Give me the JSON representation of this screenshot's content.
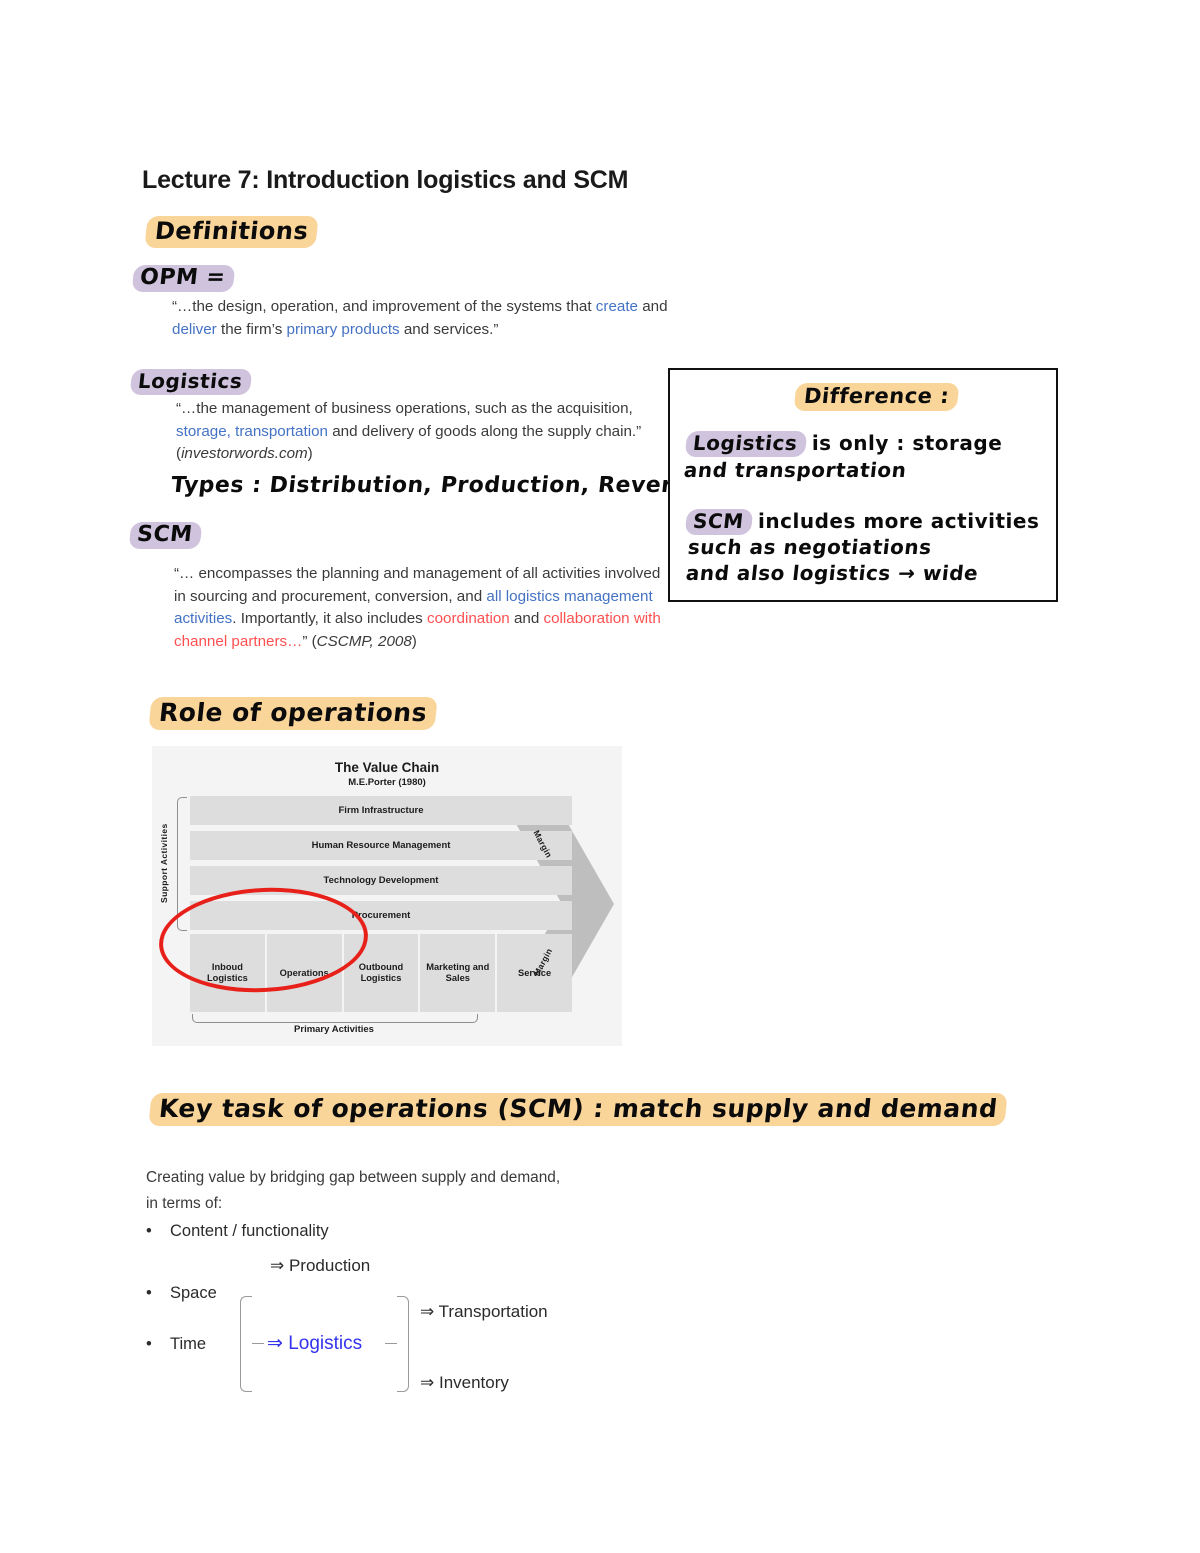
{
  "document": {
    "title": "Lecture 7: Introduction logistics and SCM"
  },
  "colors": {
    "highlight_orange": "#fad59a",
    "highlight_purple": "#cfc3de",
    "text_blue": "#4472c4",
    "text_red": "#ff5050",
    "logistics_blue": "#3333ee",
    "annotation_red": "#e8201a",
    "figure_bg": "#f4f4f4",
    "figure_box": "#dddddd",
    "figure_margin": "#bebebe"
  },
  "sections": {
    "definitions": {
      "heading": "Definitions",
      "opm": {
        "label": "OPM =",
        "quote_part1": "“…the design, operation, and improvement of the systems that ",
        "quote_create": "create",
        "quote_mid1": " and ",
        "quote_deliver": "deliver",
        "quote_mid2": " the firm’s ",
        "quote_primary": "primary products",
        "quote_end": " and services.”"
      },
      "logistics": {
        "label": "Logistics",
        "quote_part1": "“…the management of business operations, such as the acquisition, ",
        "quote_blue": "storage, transportation",
        "quote_part2": " and delivery of goods along the supply chain.” (",
        "quote_source": "investorwords.com",
        "quote_end": ")",
        "types_note": "Types : Distribution, Production, Reverse"
      },
      "scm": {
        "label": "SCM",
        "quote_part1": "“… encompasses the planning and management of all activities involved in sourcing and procurement, conversion, and ",
        "quote_blue": "all logistics management activities",
        "quote_part2": ". Importantly, it also includes ",
        "quote_red1": "coordination",
        "quote_part3": " and ",
        "quote_red2": "collaboration with channel partners…",
        "quote_part4": "” (",
        "quote_source": "CSCMP, 2008",
        "quote_end": ")"
      }
    },
    "difference_box": {
      "heading": "Difference :",
      "logistics_chip": "Logistics",
      "logistics_line1": "is only : storage",
      "logistics_line2": "and transportation",
      "scm_chip": "SCM",
      "scm_line1": "includes more activities",
      "scm_line2": "such as negotiations",
      "scm_line3": "and also logistics  → wide"
    },
    "role_of_operations": {
      "heading": "Role of operations",
      "figure": {
        "title": "The Value Chain",
        "subtitle": "M.E.Porter (1980)",
        "support_label": "Support Activities",
        "support_rows": [
          "Firm Infrastructure",
          "Human Resource Management",
          "Technology Development",
          "Procurement"
        ],
        "primary_cells": [
          "Inboud Logistics",
          "Operations",
          "Outbound Logistics",
          "Marketing and Sales",
          "Service"
        ],
        "primary_label": "Primary Activities",
        "margin_top": "Margin",
        "margin_bottom": "Margin"
      }
    },
    "key_task": {
      "heading": "Key task of operations (SCM) : match supply and demand",
      "intro_line1": "Creating value by bridging gap between supply and demand,",
      "intro_line2": "in terms of:",
      "bullets": [
        "Content / functionality",
        "Space",
        "Time"
      ],
      "production_arrow": "⇒ Production",
      "logistics_arrow": "⇒ Logistics",
      "transportation_arrow": "⇒ Transportation",
      "inventory_arrow": "⇒ Inventory"
    }
  }
}
